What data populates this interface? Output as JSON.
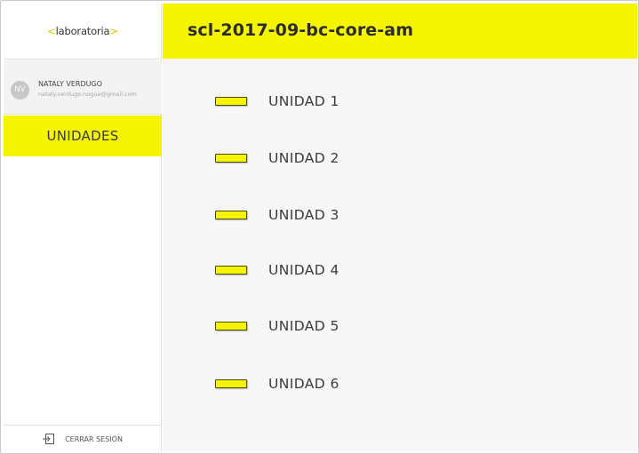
{
  "logo": {
    "open": "<",
    "text": "laboratoria",
    "close": ">"
  },
  "user": {
    "initials": "NV",
    "name": "NATALY VERDUGO",
    "email": "nataly.verdugo.nogue@gmail.com"
  },
  "nav": {
    "active_label": "UNIDADES"
  },
  "logout": {
    "label": "CERRAR SESIÓN",
    "icon": "logout-icon"
  },
  "header": {
    "title": "scl-2017-09-bc-core-am"
  },
  "units": [
    {
      "label": "UNIDAD 1"
    },
    {
      "label": "UNIDAD 2"
    },
    {
      "label": "UNIDAD 3"
    },
    {
      "label": "UNIDAD 4"
    },
    {
      "label": "UNIDAD 5"
    },
    {
      "label": "UNIDAD 6"
    }
  ],
  "colors": {
    "accent": "#f5f500",
    "text": "#3b3b3b",
    "panel": "#f7f7f7"
  }
}
